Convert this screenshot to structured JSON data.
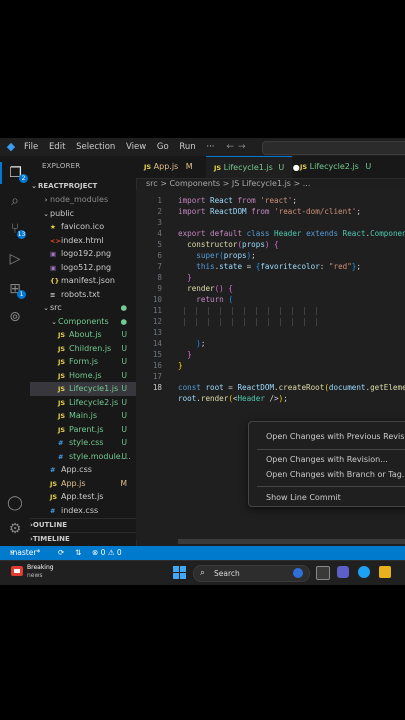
{
  "titlebar": {
    "menu": [
      "File",
      "Edit",
      "Selection",
      "View",
      "Go",
      "Run",
      "···"
    ]
  },
  "sidebar": {
    "title": "EXPLORER",
    "project": "REACTPROJECT",
    "rows": [
      {
        "label": "node_modules",
        "kind": "folder",
        "depth": 1,
        "open": false,
        "status": "",
        "dim": true
      },
      {
        "label": "public",
        "kind": "folder",
        "depth": 1,
        "open": true,
        "status": ""
      },
      {
        "label": "favicon.ico",
        "kind": "fav",
        "depth": 2,
        "status": ""
      },
      {
        "label": "index.html",
        "kind": "html",
        "depth": 2,
        "status": ""
      },
      {
        "label": "logo192.png",
        "kind": "img",
        "depth": 2,
        "status": ""
      },
      {
        "label": "logo512.png",
        "kind": "img",
        "depth": 2,
        "status": ""
      },
      {
        "label": "manifest.json",
        "kind": "json",
        "depth": 2,
        "status": ""
      },
      {
        "label": "robots.txt",
        "kind": "txt",
        "depth": 2,
        "status": ""
      },
      {
        "label": "src",
        "kind": "folder",
        "depth": 1,
        "open": true,
        "status": "dot"
      },
      {
        "label": "Components",
        "kind": "folder",
        "depth": 2,
        "open": true,
        "status": "dot",
        "green": true
      },
      {
        "label": "About.js",
        "kind": "js",
        "depth": 3,
        "status": "U",
        "green": true
      },
      {
        "label": "Children.js",
        "kind": "js",
        "depth": 3,
        "status": "U",
        "green": true
      },
      {
        "label": "Form.js",
        "kind": "js",
        "depth": 3,
        "status": "U",
        "green": true
      },
      {
        "label": "Home.js",
        "kind": "js",
        "depth": 3,
        "status": "U",
        "green": true
      },
      {
        "label": "Lifecycle1.js",
        "kind": "js",
        "depth": 3,
        "status": "U",
        "green": true,
        "selected": true
      },
      {
        "label": "Lifecycle2.js",
        "kind": "js",
        "depth": 3,
        "status": "U",
        "green": true
      },
      {
        "label": "Main.js",
        "kind": "js",
        "depth": 3,
        "status": "U",
        "green": true
      },
      {
        "label": "Parent.js",
        "kind": "js",
        "depth": 3,
        "status": "U",
        "green": true
      },
      {
        "label": "style.css",
        "kind": "css",
        "depth": 3,
        "status": "U",
        "green": true
      },
      {
        "label": "style.module....",
        "kind": "css",
        "depth": 3,
        "status": "U",
        "green": true
      },
      {
        "label": "App.css",
        "kind": "css",
        "depth": 2,
        "status": ""
      },
      {
        "label": "App.js",
        "kind": "js",
        "depth": 2,
        "status": "M",
        "mod": true
      },
      {
        "label": "App.test.js",
        "kind": "js",
        "depth": 2,
        "status": ""
      },
      {
        "label": "index.css",
        "kind": "css",
        "depth": 2,
        "status": ""
      }
    ],
    "outline": "OUTLINE",
    "timeline": "TIMELINE"
  },
  "tabs": [
    {
      "label": "App.js",
      "status": "M",
      "active": false
    },
    {
      "label": "Lifecycle1.js",
      "status": "U",
      "active": true,
      "dirty": true
    },
    {
      "label": "Lifecycle2.js",
      "status": "U",
      "active": false
    }
  ],
  "breadcrumb": "src > Components > JS Lifecycle1.js > ...",
  "editor": {
    "lines": [
      "1",
      "2",
      "3",
      "4",
      "5",
      "6",
      "7",
      "8",
      "9",
      "10",
      "11",
      "12",
      "13",
      "14",
      "15",
      "16",
      "17",
      "18"
    ],
    "current_line": "18"
  },
  "context_menu": {
    "items": [
      "Open Changes with Previous Revision",
      "Open Changes with Revision...",
      "Open Changes with Branch or Tag...",
      "Show Line Commit"
    ]
  },
  "statusbar": {
    "branch": "master*",
    "problems": "⊗ 0 ⚠ 0"
  },
  "taskbar": {
    "weather_title": "Breaking",
    "weather_sub": "news",
    "search": "Search"
  },
  "colors": {
    "accent": "#0078d4",
    "status_bar": "#007acc",
    "untracked": "#73c991",
    "modified": "#e2c08d"
  }
}
